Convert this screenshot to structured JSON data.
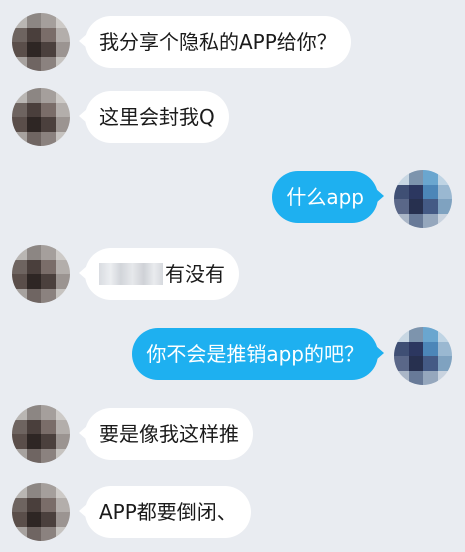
{
  "conversation": {
    "messages": [
      {
        "side": "in",
        "text": "我分享个隐私的APP给你？",
        "avatar": "contact-avatar",
        "redacted_prefix": false
      },
      {
        "side": "in",
        "text": "这里会封我Q",
        "avatar": "contact-avatar",
        "redacted_prefix": false
      },
      {
        "side": "out",
        "text": "什么app",
        "avatar": "my-avatar",
        "redacted_prefix": false
      },
      {
        "side": "in",
        "text": "有没有",
        "avatar": "contact-avatar",
        "redacted_prefix": true
      },
      {
        "side": "out",
        "text": "你不会是推销app的吧？",
        "avatar": "my-avatar",
        "redacted_prefix": false
      },
      {
        "side": "in",
        "text": "要是像我这样推",
        "avatar": "contact-avatar",
        "redacted_prefix": false
      },
      {
        "side": "in",
        "text": "APP都要倒闭、",
        "avatar": "contact-avatar",
        "redacted_prefix": false
      }
    ]
  },
  "colors": {
    "background": "#e9ecf1",
    "incoming_bubble": "#ffffff",
    "outgoing_bubble": "#1eb0f0",
    "incoming_text": "#1a1a1a",
    "outgoing_text": "#ffffff"
  },
  "avatars": {
    "contact_pixels": [
      "#b9b6b3",
      "#8c8683",
      "#a59f9c",
      "#cdcac7",
      "#6e6460",
      "#4a3f3c",
      "#7a6d69",
      "#b3aeab",
      "#5a4e4a",
      "#2e2624",
      "#4b403d",
      "#9b9491",
      "#a7a29f",
      "#6f6562",
      "#8b827f",
      "#c6c3c0"
    ],
    "me_pixels": [
      "#c8d7e3",
      "#7d94ad",
      "#6aa6cf",
      "#bfd4e4",
      "#3f4f74",
      "#2c3760",
      "#4c86b8",
      "#9ab8d1",
      "#5a6788",
      "#27304f",
      "#445a85",
      "#7fa2c0",
      "#aab6c7",
      "#687a98",
      "#95a7bd",
      "#c9d3df"
    ]
  }
}
